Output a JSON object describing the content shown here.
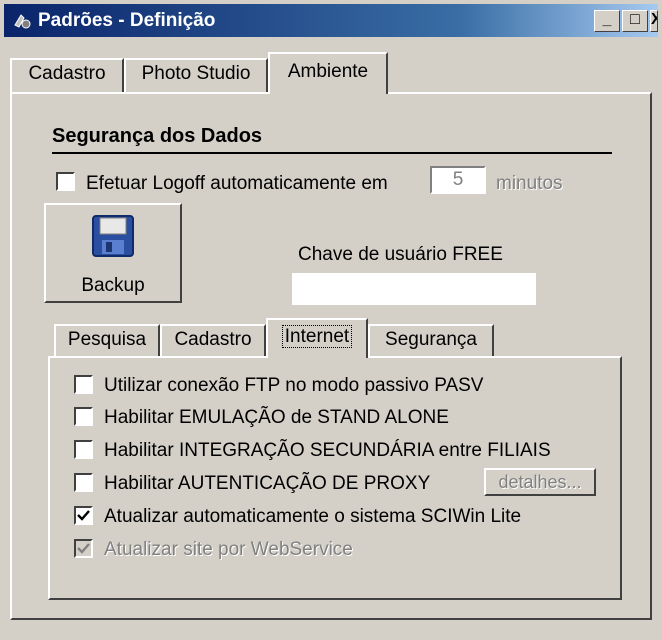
{
  "window": {
    "title": "Padrões - Definição",
    "controls": {
      "minimize": "_",
      "maximize": "□",
      "close": "X"
    }
  },
  "top_tabs": [
    {
      "label": "Cadastro"
    },
    {
      "label": "Photo Studio"
    },
    {
      "label": "Ambiente",
      "active": true
    }
  ],
  "security": {
    "heading": "Segurança dos Dados",
    "logoff_label": "Efetuar Logoff automaticamente em",
    "logoff_checked": false,
    "logoff_minutes": "5",
    "minutes_label": "minutos"
  },
  "backup": {
    "label": "Backup",
    "icon": "floppy-disk-icon"
  },
  "free_key": {
    "label": "Chave de usuário FREE",
    "value": ""
  },
  "inner_tabs": [
    {
      "label": "Pesquisa"
    },
    {
      "label": "Cadastro"
    },
    {
      "label": "Internet",
      "active": true
    },
    {
      "label": "Segurança"
    }
  ],
  "options": [
    {
      "label": "Utilizar conexão FTP no modo passivo PASV",
      "checked": false,
      "enabled": true
    },
    {
      "label": "Habilitar EMULAÇÃO de STAND ALONE",
      "checked": false,
      "enabled": true
    },
    {
      "label": "Habilitar INTEGRAÇÃO SECUNDÁRIA entre FILIAIS",
      "checked": false,
      "enabled": true
    },
    {
      "label": "Habilitar AUTENTICAÇÃO DE PROXY",
      "checked": false,
      "enabled": true
    },
    {
      "label": "Atualizar automaticamente o sistema SCIWin Lite",
      "checked": true,
      "enabled": true
    },
    {
      "label": "Atualizar site por WebService",
      "checked": true,
      "enabled": false
    }
  ],
  "proxy_details_button": "detalhes..."
}
